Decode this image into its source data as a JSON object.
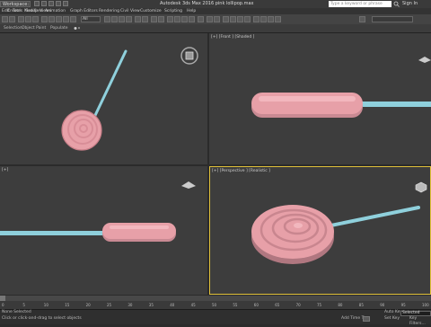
{
  "titlebar": {
    "workspace": "Workspace: Default",
    "app_title": "Autodesk 3ds Max 2016    pink lollipop.max",
    "search_placeholder": "Type a keyword or phrase",
    "signin": "Sign In"
  },
  "menu": [
    "Edit",
    "Tools",
    "Group",
    "Views",
    "Create",
    "Modifiers",
    "Animation",
    "Graph Editors",
    "Rendering",
    "Civil View",
    "Customize",
    "Scripting",
    "Help"
  ],
  "toolbar": {
    "filter": "All"
  },
  "ribbon": [
    "Selection",
    "Object Paint",
    "Populate"
  ],
  "viewports": {
    "top_left": {
      "label": ""
    },
    "top_right": {
      "label": "[+] [Front ] [Shaded ]"
    },
    "bottom_left": {
      "label": "[+]"
    },
    "bottom_right": {
      "label": "[+] [Perspective ] [Realistic ]"
    }
  },
  "timeline": {
    "frame_labels": [
      "0",
      "5",
      "10",
      "15",
      "20",
      "25",
      "30",
      "35",
      "40",
      "45",
      "50",
      "55",
      "60",
      "65",
      "70",
      "75",
      "80",
      "85",
      "90",
      "95",
      "100"
    ]
  },
  "status": {
    "selection": "None Selected",
    "prompt": "Click or click-and-drag to select objects",
    "add_time_tag": "Add Time Tag",
    "auto_key": "Auto Key",
    "set_key": "Set Key",
    "key_filter_value": "Selected",
    "key_filters": "Key Filters..."
  },
  "colors": {
    "lollipop_pink": "#e7a0a8",
    "stick_blue": "#8fd0dc",
    "active_viewport_border": "#e1c13a",
    "viewport_bg": "#3d3d3d"
  }
}
